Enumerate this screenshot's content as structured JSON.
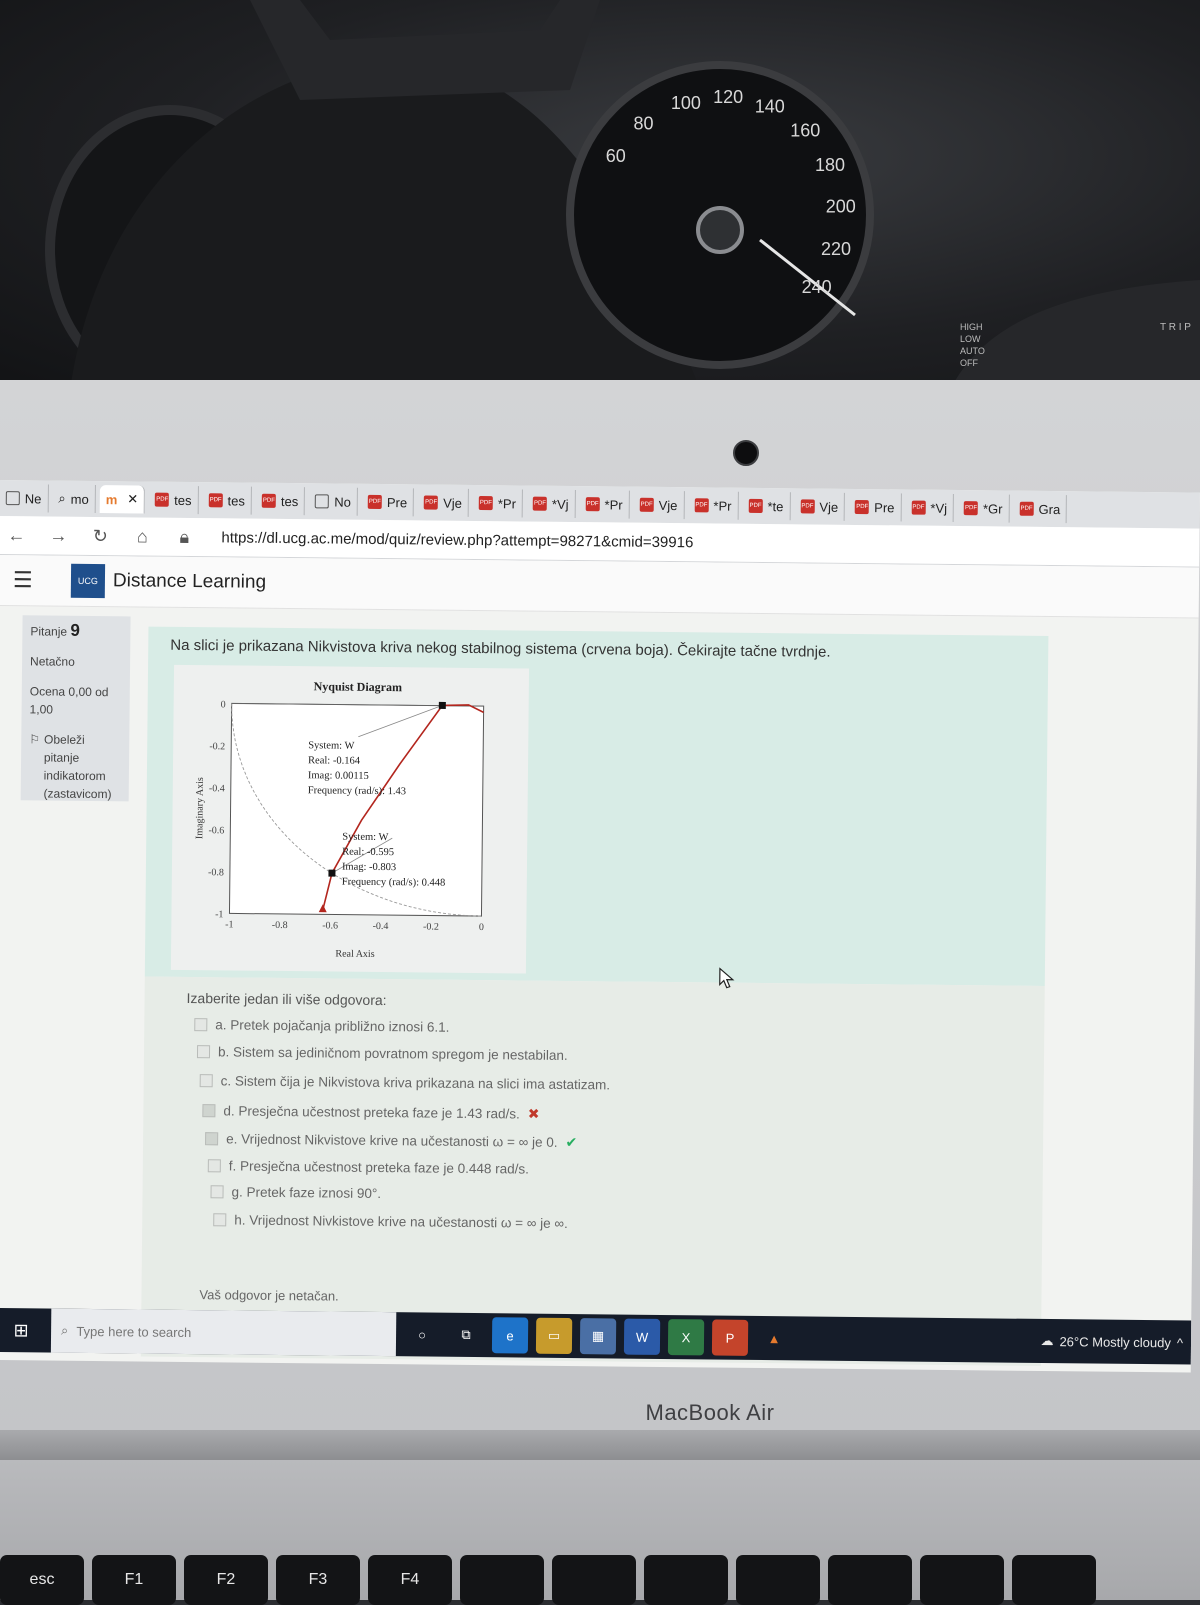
{
  "browser": {
    "tabs": [
      {
        "label": "Ne",
        "icon": "generic-icon"
      },
      {
        "label": "mo",
        "icon": "search-icon"
      },
      {
        "label": "",
        "icon": "moodle-icon",
        "active": true
      },
      {
        "label": "tes",
        "icon": "pdf-icon"
      },
      {
        "label": "tes",
        "icon": "pdf-icon"
      },
      {
        "label": "tes",
        "icon": "pdf-icon"
      },
      {
        "label": "No",
        "icon": "generic-icon"
      },
      {
        "label": "Pre",
        "icon": "pdf-icon"
      },
      {
        "label": "Vje",
        "icon": "pdf-icon"
      },
      {
        "label": "*Pr",
        "icon": "pdf-icon"
      },
      {
        "label": "*Vj",
        "icon": "pdf-icon"
      },
      {
        "label": "*Pr",
        "icon": "pdf-icon"
      },
      {
        "label": "Vje",
        "icon": "pdf-icon"
      },
      {
        "label": "*Pr",
        "icon": "pdf-icon"
      },
      {
        "label": "*te",
        "icon": "pdf-icon"
      },
      {
        "label": "Vje",
        "icon": "pdf-icon"
      },
      {
        "label": "Pre",
        "icon": "pdf-icon"
      },
      {
        "label": "*Vj",
        "icon": "pdf-icon"
      },
      {
        "label": "*Gr",
        "icon": "pdf-icon"
      },
      {
        "label": "Gra",
        "icon": "pdf-icon"
      }
    ],
    "url": "https://dl.ucg.ac.me/mod/quiz/review.php?attempt=98271&cmid=39916"
  },
  "site": {
    "logo_text": "UCG",
    "title": "Distance Learning"
  },
  "question_info": {
    "label": "Pitanje",
    "number": "9",
    "status": "Netačno",
    "grade": "Ocena 0,00 od 1,00",
    "flag": "Obeleži pitanje indikatorom (zastavicom)"
  },
  "question": {
    "text": "Na slici je prikazana Nikvistova kriva nekog stabilnog sistema (crvena boja). Čekirajte tačne tvrdnje.",
    "choose_label": "Izaberite jedan ili više odgovora:",
    "options": [
      {
        "text": "a. Pretek pojačanja približno iznosi 6.1.",
        "checked": false,
        "mark": ""
      },
      {
        "text": "b. Sistem sa jediničnom povratnom spregom je nestabilan.",
        "checked": false,
        "mark": ""
      },
      {
        "text": "c. Sistem čija je Nikvistova kriva prikazana na slici ima astatizam.",
        "checked": false,
        "mark": ""
      },
      {
        "text": "d. Presječna učestnost preteka faze je 1.43 rad/s.",
        "checked": true,
        "mark": "wrong"
      },
      {
        "text": "e. Vrijednost Nikvistove krive na učestanosti ω = ∞ je 0.",
        "checked": true,
        "mark": "correct"
      },
      {
        "text": "f. Presječna učestnost preteka faze je 0.448 rad/s.",
        "checked": false,
        "mark": ""
      },
      {
        "text": "g. Pretek faze iznosi 90°.",
        "checked": false,
        "mark": ""
      },
      {
        "text": "h. Vrijednost Nivkistove krive na učestanosti ω = ∞ je ∞.",
        "checked": false,
        "mark": ""
      }
    ],
    "feedback": "Vaš odgovor je netačan."
  },
  "chart_data": {
    "type": "line",
    "title": "Nyquist Diagram",
    "xlabel": "Real Axis",
    "ylabel": "Imaginary Axis",
    "xlim": [
      -1,
      0
    ],
    "ylim": [
      -1,
      0
    ],
    "x_ticks": [
      "-1",
      "-0.8",
      "-0.6",
      "-0.4",
      "-0.2",
      "0"
    ],
    "y_ticks": [
      "0",
      "-0.2",
      "-0.4",
      "-0.6",
      "-0.8",
      "-1"
    ],
    "series": [
      {
        "color": "#b3261e",
        "x": [
          -0.63,
          -0.595,
          -0.48,
          -0.33,
          -0.164,
          -0.06,
          0.0
        ],
        "y": [
          -0.98,
          -0.803,
          -0.55,
          -0.28,
          0.00115,
          0.005,
          -0.03
        ]
      }
    ],
    "unit_circle": true,
    "datatips": [
      {
        "lines": [
          "System: W",
          "Real: -0.164",
          "Imag: 0.00115",
          "Frequency (rad/s): 1.43"
        ],
        "x": -0.164,
        "y": 0.00115
      },
      {
        "lines": [
          "System: W",
          "Real: -0.595",
          "Imag: -0.803",
          "Frequency (rad/s): 0.448"
        ],
        "x": -0.595,
        "y": -0.803
      }
    ]
  },
  "taskbar": {
    "search_placeholder": "Type here to search",
    "apps": [
      "cortana-icon",
      "task-view-icon",
      "edge-icon",
      "file-explorer-icon",
      "store-icon",
      "word-icon",
      "excel-icon",
      "powerpoint-icon",
      "matlab-icon"
    ],
    "weather": "26°C  Mostly cloudy"
  },
  "laptop": {
    "brand": "MacBook Air",
    "keys": [
      "esc",
      "F1",
      "F2",
      "F3",
      "F4",
      "",
      "",
      "",
      "",
      "",
      "",
      ""
    ]
  },
  "dashboard": {
    "speedo_labels": [
      "60",
      "80",
      "100",
      "120",
      "140",
      "160",
      "180",
      "200",
      "220",
      "240"
    ],
    "stalk_labels": [
      "HIGH",
      "LOW",
      "AUTO",
      "OFF",
      "T R I P"
    ]
  }
}
